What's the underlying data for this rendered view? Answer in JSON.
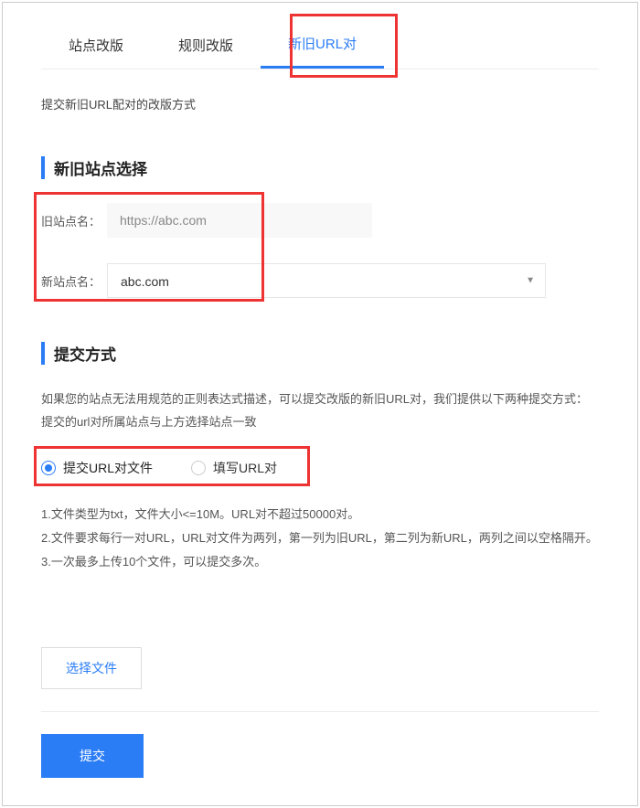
{
  "tabs": {
    "site": "站点改版",
    "rule": "规则改版",
    "urlpair": "新旧URL对"
  },
  "intro": "提交新旧URL配对的改版方式",
  "section1": {
    "title": "新旧站点选择",
    "old_label": "旧站点名：",
    "old_value": "https://abc.com",
    "new_label": "新站点名：",
    "new_value": "abc.com"
  },
  "section2": {
    "title": "提交方式",
    "desc1": "如果您的站点无法用规范的正则表达式描述，可以提交改版的新旧URL对，我们提供以下两种提交方式：",
    "desc2": "提交的url对所属站点与上方选择站点一致",
    "radio1": "提交URL对文件",
    "radio2": "填写URL对",
    "rule1": "1.文件类型为txt，文件大小<=10M。URL对不超过50000对。",
    "rule2": "2.文件要求每行一对URL，URL对文件为两列，第一列为旧URL，第二列为新URL，两列之间以空格隔开。",
    "rule3": "3.一次最多上传10个文件，可以提交多次。"
  },
  "buttons": {
    "choose_file": "选择文件",
    "submit": "提交"
  }
}
